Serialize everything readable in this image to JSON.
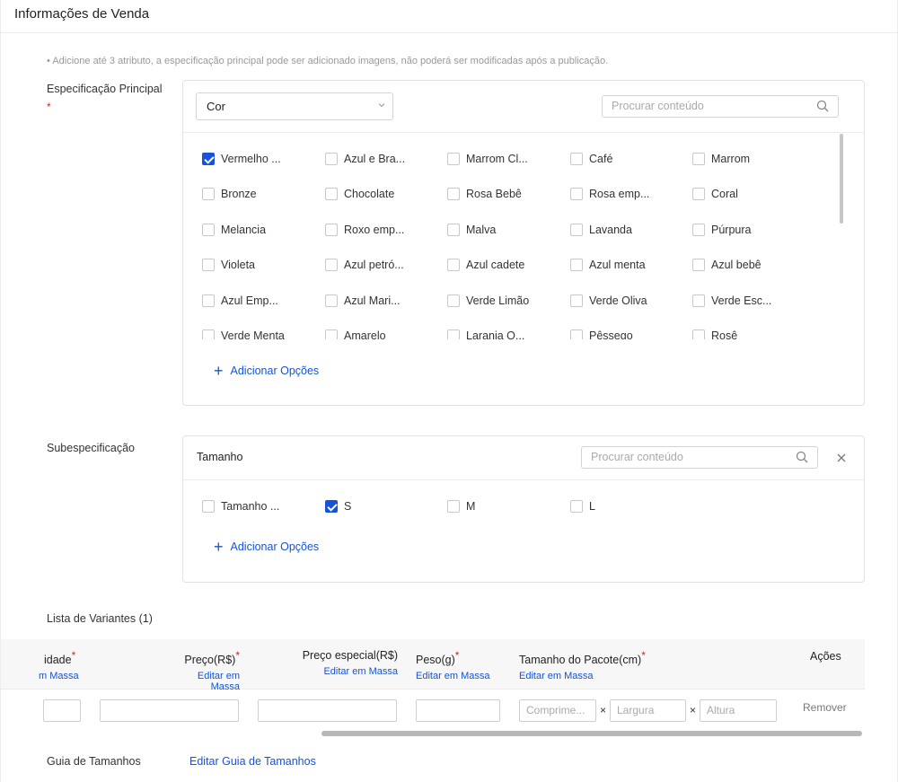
{
  "header": {
    "title": "Informações de Venda"
  },
  "note": "Adicione até 3 atributo, a especificação principal pode ser adicionado imagens, não poderá ser modificadas após a publicação.",
  "main_spec": {
    "label": "Especificação Principal",
    "required": "*",
    "select_value": "Cor",
    "search_placeholder": "Procurar conteúdo",
    "options": [
      {
        "label": "Vermelho ...",
        "checked": true
      },
      {
        "label": "Azul e Bra...",
        "checked": false
      },
      {
        "label": "Marrom Cl...",
        "checked": false
      },
      {
        "label": "Café",
        "checked": false
      },
      {
        "label": "Marrom",
        "checked": false
      },
      {
        "label": "Bronze",
        "checked": false
      },
      {
        "label": "Chocolate",
        "checked": false
      },
      {
        "label": "Rosa Bebê",
        "checked": false
      },
      {
        "label": "Rosa emp...",
        "checked": false
      },
      {
        "label": "Coral",
        "checked": false
      },
      {
        "label": "Melancia",
        "checked": false
      },
      {
        "label": "Roxo emp...",
        "checked": false
      },
      {
        "label": "Malva",
        "checked": false
      },
      {
        "label": "Lavanda",
        "checked": false
      },
      {
        "label": "Púrpura",
        "checked": false
      },
      {
        "label": "Violeta",
        "checked": false
      },
      {
        "label": "Azul petró...",
        "checked": false
      },
      {
        "label": "Azul cadete",
        "checked": false
      },
      {
        "label": "Azul menta",
        "checked": false
      },
      {
        "label": "Azul bebê",
        "checked": false
      },
      {
        "label": "Azul Emp...",
        "checked": false
      },
      {
        "label": "Azul Mari...",
        "checked": false
      },
      {
        "label": "Verde Limão",
        "checked": false
      },
      {
        "label": "Verde Oliva",
        "checked": false
      },
      {
        "label": "Verde Esc...",
        "checked": false
      },
      {
        "label": "Verde Menta",
        "checked": false
      },
      {
        "label": "Amarelo",
        "checked": false
      },
      {
        "label": "Laranja Q...",
        "checked": false
      },
      {
        "label": "Pêssego",
        "checked": false
      },
      {
        "label": "Rosê",
        "checked": false
      }
    ],
    "add_label": "Adicionar Opções"
  },
  "sub_spec": {
    "label": "Subespecificação",
    "title": "Tamanho",
    "search_placeholder": "Procurar conteúdo",
    "options": [
      {
        "label": "Tamanho ...",
        "checked": false
      },
      {
        "label": "S",
        "checked": true
      },
      {
        "label": "M",
        "checked": false
      },
      {
        "label": "L",
        "checked": false
      }
    ],
    "add_label": "Adicionar Opções"
  },
  "variants": {
    "label": "Lista de Variantes (1)",
    "columns": [
      {
        "title": "idade",
        "required": "*",
        "link": "m Massa"
      },
      {
        "title": "Preço(R$)",
        "required": "*",
        "link": "Editar em Massa"
      },
      {
        "title": "Preço especial(R$)",
        "required": "",
        "link": "Editar em Massa"
      },
      {
        "title": "Peso(g)",
        "required": "*",
        "link": "Editar em Massa"
      },
      {
        "title": "Tamanho do Pacote(cm)",
        "required": "*",
        "link": "Editar em Massa"
      },
      {
        "title": "Ações",
        "required": "",
        "link": ""
      }
    ],
    "row": {
      "length_placeholder": "Comprime...",
      "width_placeholder": "Largura",
      "height_placeholder": "Altura",
      "times": "×",
      "remove_label": "Remover"
    }
  },
  "size_guide": {
    "label": "Guia de Tamanhos",
    "link": "Editar Guia de Tamanhos"
  },
  "colors": {
    "accent": "#1653d6",
    "required": "#e02020"
  }
}
